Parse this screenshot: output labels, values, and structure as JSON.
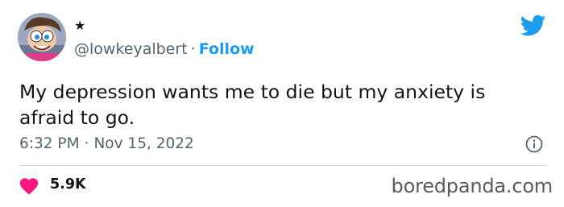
{
  "tweet": {
    "display_name": "★",
    "handle": "@lowkeyalbert",
    "separator": "·",
    "follow_label": "Follow",
    "text": "My depression wants me to die but my anxiety is afraid to go.",
    "time": "6:32 PM",
    "date": "Nov 15, 2022",
    "like_count": "5.9K"
  },
  "watermark": "boredpanda.com",
  "icons": {
    "brand": "twitter-bird-icon",
    "info": "info-icon",
    "like": "heart-icon"
  },
  "colors": {
    "twitter_blue": "#1d9bf0",
    "like_red": "#f91880",
    "text": "#0f1419",
    "muted": "#536471",
    "divider": "#cfd9de"
  }
}
